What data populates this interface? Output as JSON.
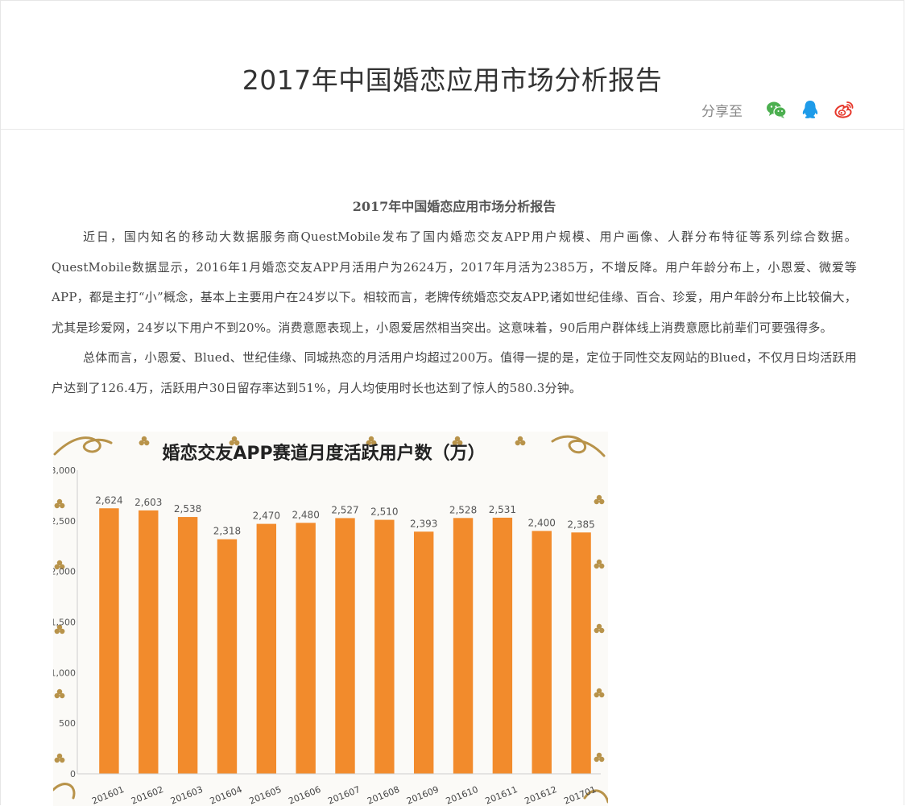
{
  "header": {
    "title": "2017年中国婚恋应用市场分析报告",
    "share_label": "分享至",
    "share_icons": [
      "wechat-icon",
      "qq-icon",
      "weibo-icon"
    ],
    "colors": {
      "wechat": "#4caf50",
      "qq": "#1e9be9",
      "weibo": "#e6382c"
    }
  },
  "article": {
    "title": "2017年中国婚恋应用市场分析报告",
    "paragraphs": [
      "近日，国内知名的移动大数据服务商QuestMobile发布了国内婚恋交友APP用户规模、用户画像、人群分布特征等系列综合数据。QuestMobile数据显示，2016年1月婚恋交友APP月活用户为2624万，2017年月活为2385万，不增反降。用户年龄分布上，小恩爱、微爱等APP，都是主打“小”概念，基本上主要用户在24岁以下。相较而言，老牌传统婚恋交友APP,诸如世纪佳缘、百合、珍爱，用户年龄分布上比较偏大，尤其是珍爱网，24岁以下用户不到20%。消费意愿表现上，小恩爱居然相当突出。这意味着，90后用户群体线上消费意愿比前辈们可要强得多。",
      "总体而言，小恩爱、Blued、世纪佳缘、同城热恋的月活用户均超过200万。值得一提的是，定位于同性交友网站的Blued，不仅月日均活跃用户达到了126.4万，活跃用户30日留存率达到51%，月人均使用时长也达到了惊人的580.3分钟。"
    ]
  },
  "chart_data": {
    "type": "bar",
    "title": "婚恋交友APP赛道月度活跃用户数（万）",
    "categories": [
      "201601",
      "201602",
      "201603",
      "201604",
      "201605",
      "201606",
      "201607",
      "201608",
      "201609",
      "201610",
      "201611",
      "201612",
      "201701"
    ],
    "values": [
      2624,
      2603,
      2538,
      2318,
      2470,
      2480,
      2527,
      2510,
      2393,
      2528,
      2531,
      2400,
      2385
    ],
    "value_labels": [
      "2,624",
      "2,603",
      "2,538",
      "2,318",
      "2,470",
      "2,480",
      "2,527",
      "2,510",
      "2,393",
      "2,528",
      "2,531",
      "2,400",
      "2,385"
    ],
    "yticks": [
      0,
      500,
      1000,
      1500,
      2000,
      2500,
      3000
    ],
    "ytick_labels": [
      "0",
      "500",
      "1,000",
      "1,500",
      "2,000",
      "2,500",
      "3,000"
    ],
    "ylim": [
      0,
      3000
    ],
    "grid": false,
    "legend": "none",
    "colors": {
      "bar": "#f28b2c",
      "title": "#222222",
      "label": "#555555",
      "decor": "#b8934a"
    }
  }
}
